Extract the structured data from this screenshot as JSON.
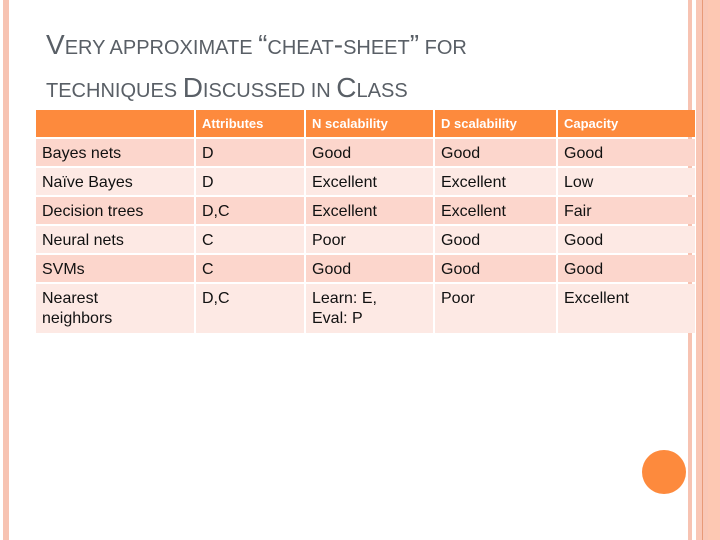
{
  "slide": {
    "title_line1": [
      {
        "text": "V",
        "size": "big"
      },
      {
        "text": "ERY APPROXIMATE ",
        "size": "small"
      },
      {
        "text": "“",
        "size": "big"
      },
      {
        "text": "CHEAT",
        "size": "small"
      },
      {
        "text": "-",
        "size": "big"
      },
      {
        "text": "SHEET",
        "size": "small"
      },
      {
        "text": "”",
        "size": "big"
      },
      {
        "text": " FOR",
        "size": "small"
      }
    ],
    "title_line2": [
      {
        "text": "TECHNIQUES ",
        "size": "small"
      },
      {
        "text": "D",
        "size": "big"
      },
      {
        "text": "ISCUSSED IN ",
        "size": "small"
      },
      {
        "text": "C",
        "size": "big"
      },
      {
        "text": "LASS",
        "size": "small"
      }
    ],
    "colors": {
      "header_bg": "#fd8a3d",
      "row_dark": "#fcd6cc",
      "row_light": "#fde9e4",
      "accent_circle": "#fd8a3d",
      "border_stripe": "#f7c3b2"
    }
  },
  "table": {
    "headers": [
      "",
      "Attributes",
      "N scalability",
      "D scalability",
      "Capacity"
    ],
    "rows": [
      [
        "Bayes nets",
        "D",
        "Good",
        "Good",
        "Good"
      ],
      [
        "Naïve Bayes",
        "D",
        "Excellent",
        "Excellent",
        "Low"
      ],
      [
        "Decision trees",
        "D,C",
        "Excellent",
        "Excellent",
        "Fair"
      ],
      [
        "Neural nets",
        "C",
        "Poor",
        "Good",
        "Good"
      ],
      [
        "SVMs",
        "C",
        "Good",
        "Good",
        "Good"
      ],
      [
        "Nearest neighbors",
        "D,C",
        "Learn: E, Eval: P",
        "Poor",
        "Excellent"
      ]
    ]
  }
}
